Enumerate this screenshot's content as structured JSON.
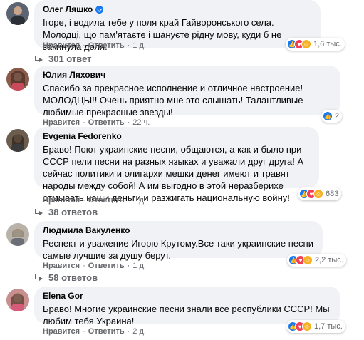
{
  "action_like": "Нравится",
  "action_reply": "Ответить",
  "comments": [
    {
      "author": "Олег Ляшко",
      "verified": true,
      "text": "Ігоре, і водила тебе у поля край Гайворонського села. Молодці, що пам'ятаєте і шануєте рідну мову, куди б не закинула доля.",
      "time": "1 д.",
      "reaction_count": "1,6 тыс.",
      "reactions": [
        "like-icon",
        "love-icon",
        "care-icon"
      ],
      "replies": "301 ответ"
    },
    {
      "author": "Юлия Ляхович",
      "text": "Спасибо за прекрасное исполнение и отличное настроение! МОЛОДЦЫ!! Очень приятно мне это слышать! Талантливые любимые прекрасные звезды!",
      "time": "22 ч.",
      "reaction_count": "2",
      "reactions": [
        "like-icon"
      ]
    },
    {
      "author": "Evgenia Fedorenko",
      "text": "Браво! Поют украинские песни, общаются, а как и было при СССР пели песни на разных языках и уважали друг друга! А сейчас политики и олигархи мешки денег имеют и травят народы между собой! А им выгодно в этой неразберихе отмывать наши деньги и разжигать национальную войну!",
      "time": "1 д.",
      "reaction_count": "683",
      "reactions": [
        "like-icon",
        "love-icon",
        "care-icon"
      ],
      "replies": "38 ответов"
    },
    {
      "author": "Людмила Вакуленко",
      "text": "Респект и уважение Игорю Крутому.Все таки украинские песни самые лучшие за душу берут.",
      "time": "1 д.",
      "reaction_count": "2,2 тыс.",
      "reactions": [
        "like-icon",
        "love-icon",
        "care-icon"
      ],
      "replies": "58 ответов"
    },
    {
      "author": "Elena Gor",
      "text": "Браво! Многие украинские песни знали все республики СССР! Мы любим тебя Украина!",
      "time": "2 д.",
      "reaction_count": "1,7 тыс.",
      "reactions": [
        "like-icon",
        "love-icon",
        "care-icon"
      ]
    }
  ]
}
